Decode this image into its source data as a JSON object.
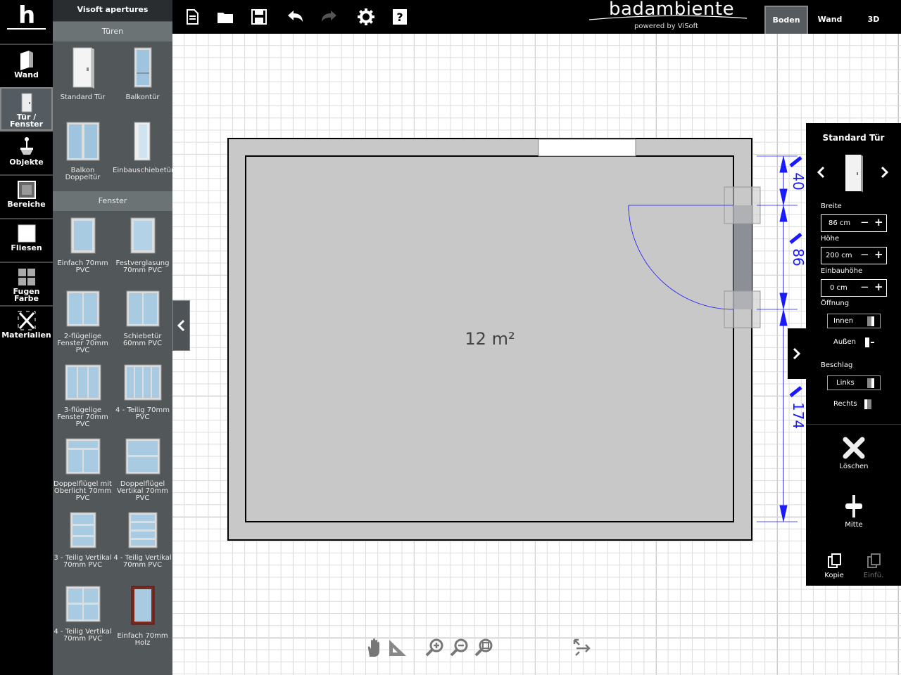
{
  "left_tools": [
    {
      "label": "Wand",
      "icon": "wall-icon"
    },
    {
      "label": "Tür /\nFenster",
      "icon": "door-icon",
      "active": true
    },
    {
      "label": "Objekte",
      "icon": "objects-icon"
    },
    {
      "label": "Bereiche",
      "icon": "areas-icon"
    },
    {
      "label": "Fliesen",
      "icon": "tiles-icon"
    },
    {
      "label": "Fugen\nFarbe",
      "icon": "grout-color-icon"
    },
    {
      "label": "Materialien",
      "icon": "materials-icon"
    }
  ],
  "catalog": {
    "title": "Visoft apertures",
    "sections": [
      {
        "header": "Türen",
        "items": [
          "Standard Tür",
          "Balkontür",
          "Balkon Doppeltür",
          "Einbauschiebetür"
        ]
      },
      {
        "header": "Fenster",
        "items": [
          "Einfach 70mm PVC",
          "Festverglasung 70mm PVC",
          "2-flügelige Fenster 70mm PVC",
          "Schiebetür 60mm PVC",
          "3-flügelige Fenster 70mm PVC",
          "4 - Teilig 70mm PVC",
          "Doppelflügel mit Oberlicht 70mm PVC",
          "Doppelflügel Vertikal 70mm PVC",
          "3 - Teilig Vertikal 70mm PVC",
          "4 - Teilig Vertikal 70mm PVC",
          "4 - Teilig Vertikal 70mm PVC",
          "Einfach 70mm Holz"
        ]
      }
    ]
  },
  "toolbar": {
    "icons": [
      "new-document-icon",
      "open-folder-icon",
      "save-icon",
      "undo-icon",
      "redo-icon",
      "settings-icon",
      "help-icon"
    ]
  },
  "brand": {
    "name": "badambiente",
    "subtitle": "powered by ViSoft"
  },
  "view_tabs": [
    {
      "label": "Boden",
      "active": true
    },
    {
      "label": "Wand"
    },
    {
      "label": "3D"
    }
  ],
  "plan": {
    "area_label": "12 m²",
    "dimensions": [
      "40",
      "86",
      "174"
    ]
  },
  "properties": {
    "title": "Standard Tür",
    "breite_label": "Breite",
    "breite_value": "86 cm",
    "hoehe_label": "Höhe",
    "hoehe_value": "200 cm",
    "einbauhoehe_label": "Einbauhöhe",
    "einbauhoehe_value": "0 cm",
    "oeffnung_label": "Öffnung",
    "oeffnung_selected": "Innen",
    "oeffnung_other": "Außen",
    "beschlag_label": "Beschlag",
    "beschlag_selected": "Links",
    "beschlag_other": "Rechts",
    "minus": "−",
    "plus": "+"
  },
  "actions": {
    "delete": "Löschen",
    "center": "Mitte",
    "copy": "Kopie",
    "paste": "Einfü."
  },
  "bottom_tools": [
    "pan-hand-icon",
    "measure-icon",
    "zoom-in-icon",
    "zoom-out-icon",
    "zoom-fit-icon",
    "reset-icon"
  ],
  "colors": {
    "panel_bg": "#525759",
    "dimension_blue": "#1a1aff",
    "wall_gray": "#c8c8c8"
  }
}
